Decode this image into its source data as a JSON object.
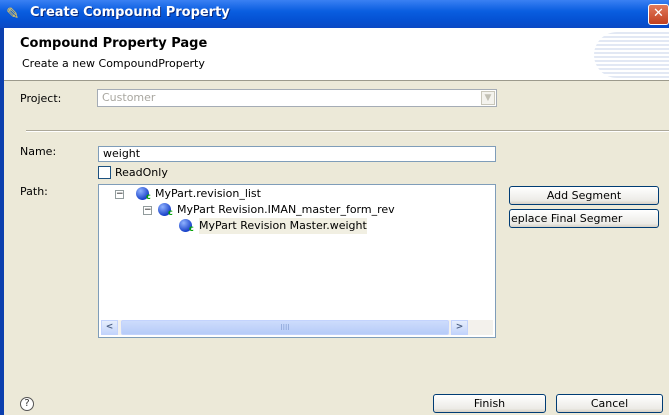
{
  "window": {
    "title": "Create Compound Property",
    "close": "✕"
  },
  "banner": {
    "title": "Compound Property Page",
    "description": "Create a new CompoundProperty"
  },
  "form": {
    "project_label": "Project:",
    "project_value": "Customer",
    "name_label": "Name:",
    "name_value": "weight",
    "readonly_label": "ReadOnly",
    "path_label": "Path:"
  },
  "tree": {
    "nodes": [
      {
        "label": "MyPart.revision_list",
        "expander": "−",
        "icon": "business-object-icon"
      },
      {
        "label": "MyPart Revision.IMAN_master_form_rev",
        "expander": "−",
        "icon": "business-object-icon"
      },
      {
        "label": "MyPart Revision Master.weight",
        "icon": "business-object-icon"
      }
    ],
    "scroll_left": "<",
    "scroll_right": ">",
    "thumb_grip": "IIII"
  },
  "buttons": {
    "add_segment": "Add Segment",
    "replace_final": "eplace Final Segmer",
    "finish": "Finish",
    "cancel": "Cancel",
    "help": "?"
  }
}
